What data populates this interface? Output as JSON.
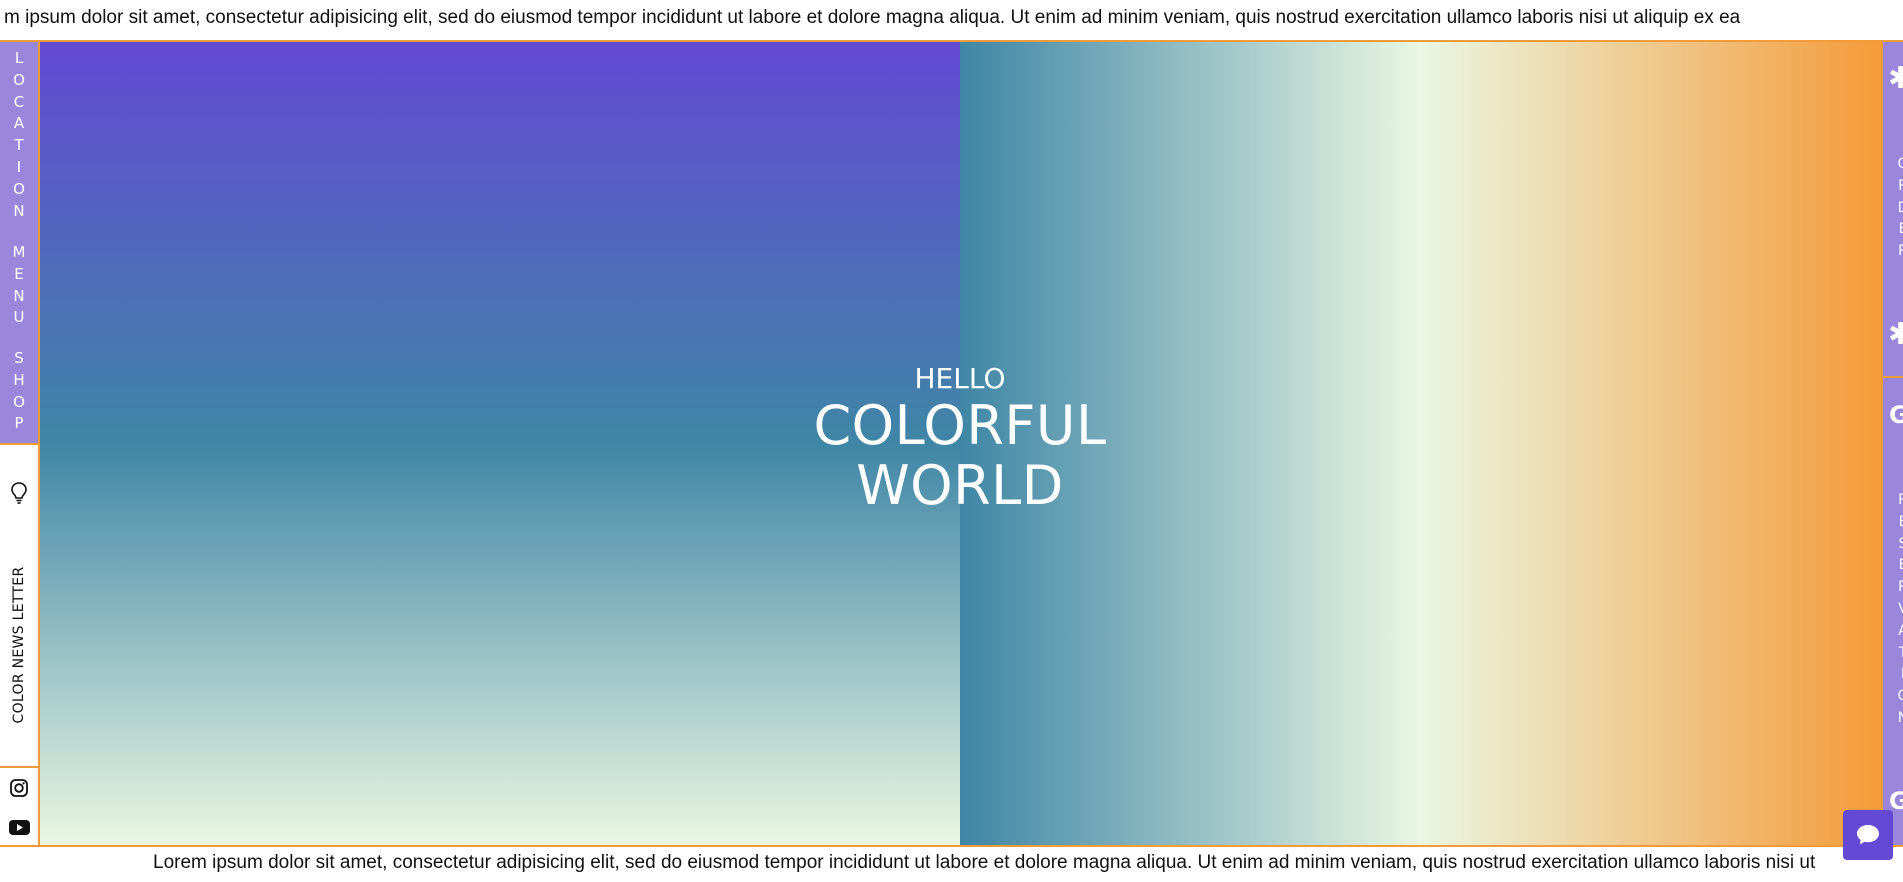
{
  "ticker": {
    "top_text": "m ipsum dolor sit amet, consectetur adipisicing elit, sed do eiusmod tempor incididunt ut labore et dolore magna aliqua. Ut enim ad minim veniam, quis nostrud exercitation ullamco laboris nisi ut aliquip ex ea",
    "bottom_text": "Lorem ipsum dolor sit amet, consectetur adipisicing elit, sed do eiusmod tempor incididunt ut labore et dolore magna aliqua. Ut enim ad minim veniam, quis nostrud exercitation ullamco laboris nisi ut"
  },
  "left_sidebar": {
    "menu_items": [
      {
        "label": "LOCATION",
        "letters": [
          "L",
          "O",
          "C",
          "A",
          "T",
          "I",
          "O",
          "N"
        ]
      },
      {
        "label": "MENU",
        "letters": [
          "M",
          "E",
          "N",
          "U"
        ]
      },
      {
        "label": "SHOP",
        "letters": [
          "S",
          "H",
          "O",
          "P"
        ]
      }
    ],
    "newsletter_label": "COLOR NEWS LETTER",
    "newsletter_icon": "lightbulb-icon",
    "social_icons": [
      "instagram-icon",
      "youtube-icon"
    ]
  },
  "hero": {
    "greeting": "HELLO",
    "title_line1": "COLORFUL",
    "title_line2": "WORLD"
  },
  "right_sidebar": {
    "order": {
      "label": "ORDER",
      "letters": [
        "O",
        "R",
        "D",
        "E",
        "R"
      ],
      "icon": "asterisk-icon",
      "icon_char": "✱"
    },
    "reservation": {
      "label": "RESERVATION",
      "letters": [
        "R",
        "E",
        "S",
        "E",
        "R",
        "V",
        "A",
        "T",
        "I",
        "O",
        "N"
      ],
      "icon": "g-icon",
      "icon_char": "G"
    }
  },
  "chat": {
    "icon": "chat-icon"
  },
  "colors": {
    "accent_orange": "#f49b39",
    "purple": "#6349d4",
    "lavender": "#9a87dc",
    "teal": "#3f86a6",
    "mint": "#eaf7e2"
  }
}
